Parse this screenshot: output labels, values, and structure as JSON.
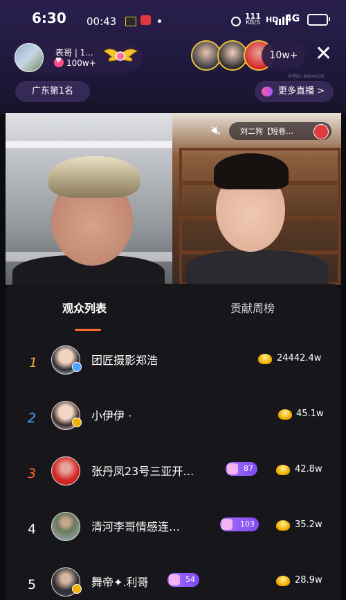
{
  "status_bar": {
    "time": "6:30",
    "network_speed": "111",
    "network_unit": "KB/S",
    "hd": "HD",
    "carrier": "4G"
  },
  "recording": {
    "elapsed": "00:43"
  },
  "host": {
    "name": "表哥 | 1...",
    "likes": "100w+"
  },
  "viewers": {
    "count": "10w+"
  },
  "room": {
    "id_label": "抖音ID: 86644305"
  },
  "rank_badge": "广东第1名",
  "more_live": "更多直播 >",
  "pk_opponent": "刘二狗【短卷…",
  "tabs": {
    "audience": "观众列表",
    "contribution": "贡献周榜"
  },
  "list": [
    {
      "rank": "1",
      "name": "团匠摄影郑浩",
      "score": "24442.4w",
      "level": ""
    },
    {
      "rank": "2",
      "name": "小伊伊 ·",
      "score": "45.1w",
      "level": ""
    },
    {
      "rank": "3",
      "name": "张丹凤23号三亚开…",
      "score": "42.8w",
      "level": "87"
    },
    {
      "rank": "4",
      "name": "清河李哥情感连…",
      "score": "35.2w",
      "level": "103"
    },
    {
      "rank": "5",
      "name": "舞帝✦.利哥",
      "score": "28.9w",
      "level": "54"
    }
  ],
  "colors": {
    "accent_orange": "#ff6a2b",
    "rank_top3": "#f2a93b",
    "level_purple": "#8a55f5",
    "ingot_gold": "#f2b200"
  }
}
